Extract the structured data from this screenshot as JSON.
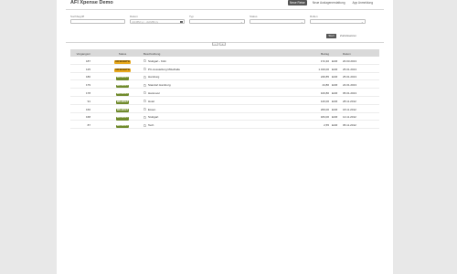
{
  "app": {
    "title": "AFI Xpense Demo"
  },
  "nav": [
    {
      "label": "Neue Reise",
      "active": true
    },
    {
      "label": "Neue Auslagenerstattung",
      "active": false
    },
    {
      "label": "App Anmeldung",
      "active": false
    }
  ],
  "filters": {
    "suchbegriff": {
      "label": "Suchbegriff",
      "value": ""
    },
    "datum": {
      "label": "Datum",
      "value": "dd.MM.yy - dd.MM.yy"
    },
    "typ": {
      "label": "Typ",
      "value": ""
    },
    "status": {
      "label": "Status",
      "value": ""
    },
    "rollen": {
      "label": "Rollen",
      "value": ""
    },
    "start_label": "Start",
    "reset_label": "Zurücksetzen"
  },
  "toggles": [
    "−",
    "+"
  ],
  "table": {
    "headers": {
      "vorgang": "Vorgangsnr",
      "status": "Status",
      "beschreibung": "Beschreibung",
      "betrag": "Betrag",
      "datum": "Datum"
    },
    "rows": [
      {
        "vorgang": "187",
        "status": "OFFEN/ENTW",
        "status_kind": "open",
        "beschreibung": "Stuttgart - Köln",
        "betrag": "172,40",
        "waehrung": "EUR",
        "datum": "20.03.2013"
      },
      {
        "vorgang": "125",
        "status": "OFFEN/ENTW",
        "status_kind": "open",
        "beschreibung": "PC-Ausstellung Mittelhalle",
        "betrag": "1.019,00",
        "waehrung": "EUR",
        "datum": "25.01.2013"
      },
      {
        "vorgang": "180",
        "status": "ERLEDIGT",
        "status_kind": "done",
        "beschreibung": "Hamburg",
        "betrag": "249,85",
        "waehrung": "EUR",
        "datum": "25.01.2013"
      },
      {
        "vorgang": "179",
        "status": "ERLEDIGT",
        "status_kind": "done",
        "beschreibung": "Standort Hamburg",
        "betrag": "44,80",
        "waehrung": "EUR",
        "datum": "24.01.2013"
      },
      {
        "vorgang": "178",
        "status": "ERLEDIGT",
        "status_kind": "done",
        "beschreibung": "Hannover",
        "betrag": "100,80",
        "waehrung": "EUR",
        "datum": "05.01.2013"
      },
      {
        "vorgang": "91",
        "status": "ERLEDIGT",
        "status_kind": "done",
        "beschreibung": "Hotel",
        "betrag": "120,00",
        "waehrung": "EUR",
        "datum": "28.11.2012"
      },
      {
        "vorgang": "166",
        "status": "ERLEDIGT",
        "status_kind": "done",
        "beschreibung": "Essen",
        "betrag": "209,00",
        "waehrung": "EUR",
        "datum": "18.11.2012"
      },
      {
        "vorgang": "168",
        "status": "ERLEDIGT",
        "status_kind": "done",
        "beschreibung": "Stuttgart",
        "betrag": "184,00",
        "waehrung": "EUR",
        "datum": "14.11.2012"
      },
      {
        "vorgang": "87",
        "status": "ERLEDIGT",
        "status_kind": "done",
        "beschreibung": "Tech",
        "betrag": "2,55",
        "waehrung": "EUR",
        "datum": "05.11.2012"
      }
    ]
  },
  "colors": {
    "open_badge": "#e8a81c",
    "done_badge": "#6f8a2b",
    "header_row": "#d9d9d9",
    "nav_active": "#555555"
  },
  "icons": {
    "row_icon": "document-icon",
    "date_icon": "calendar-icon",
    "dropdown_icon": "chevron-down-icon"
  }
}
